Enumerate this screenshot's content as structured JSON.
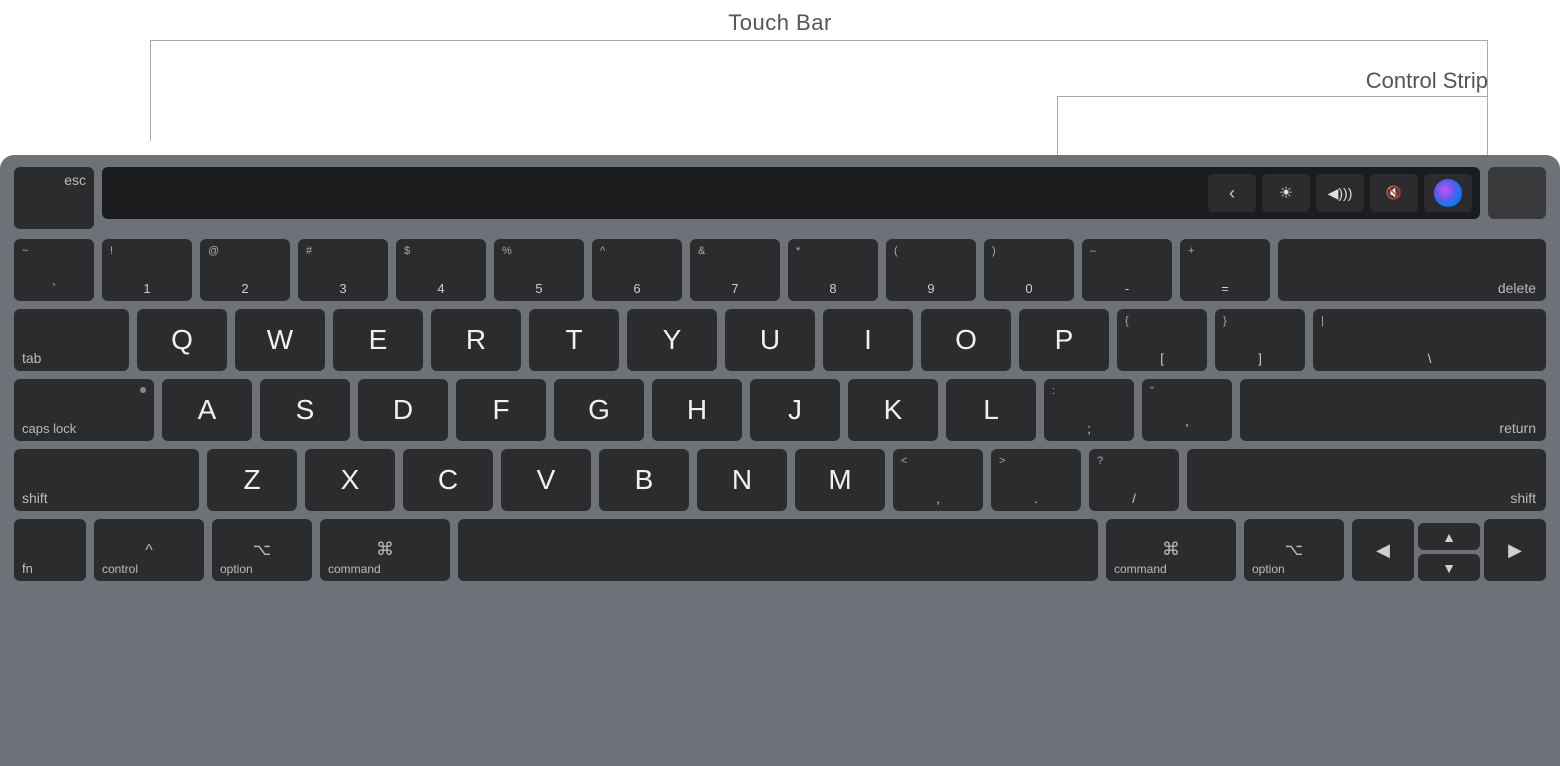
{
  "labels": {
    "touch_bar": "Touch Bar",
    "control_strip": "Control Strip"
  },
  "touchbar": {
    "icons": [
      "‹",
      "☀",
      "◀)))",
      "🔇",
      "siri"
    ]
  },
  "keys": {
    "esc": "esc",
    "row1": [
      "~\n`",
      "!\n1",
      "@\n2",
      "#\n3",
      "$\n4",
      "%\n5",
      "^\n6",
      "&\n7",
      "*\n8",
      "(\n9",
      ")\n0",
      "–\n-",
      "+\n=",
      "delete"
    ],
    "row2": [
      "tab",
      "Q",
      "W",
      "E",
      "R",
      "T",
      "Y",
      "U",
      "I",
      "O",
      "P",
      "{\n[",
      "}\n]",
      "|\n\\"
    ],
    "row3": [
      "caps lock",
      "A",
      "S",
      "D",
      "F",
      "G",
      "H",
      "J",
      "K",
      "L",
      ":\n;",
      "\"\n'",
      "return"
    ],
    "row4": [
      "shift",
      "Z",
      "X",
      "C",
      "V",
      "B",
      "N",
      "M",
      "<\n,",
      ">\n.",
      "?\n/",
      "shift"
    ],
    "row5": [
      "fn",
      "control",
      "option",
      "command",
      "",
      "command",
      "option",
      "▲",
      "▼",
      "◀",
      "▶"
    ]
  }
}
